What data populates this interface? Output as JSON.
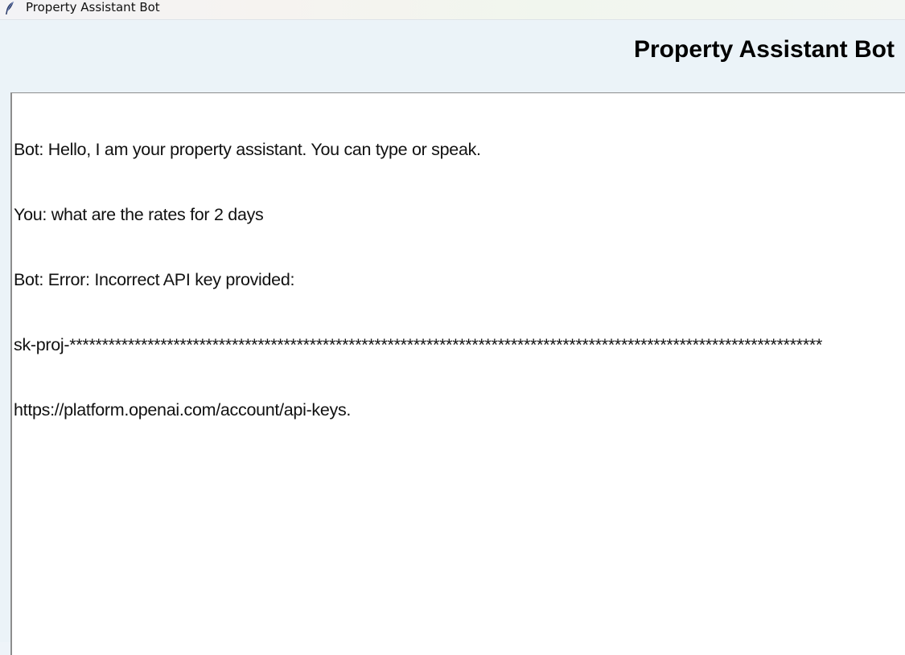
{
  "window": {
    "title": "Property Assistant Bot",
    "icon": "feather-icon"
  },
  "header": {
    "heading": "Property Assistant Bot"
  },
  "chat": {
    "lines": [
      "Bot: Hello, I am your property assistant. You can type or speak.",
      "You: what are the rates for 2 days",
      "Bot: Error: Incorrect API key provided:",
      "sk-proj-********************************************************************************************************************",
      "https://platform.openai.com/account/api-keys."
    ]
  }
}
